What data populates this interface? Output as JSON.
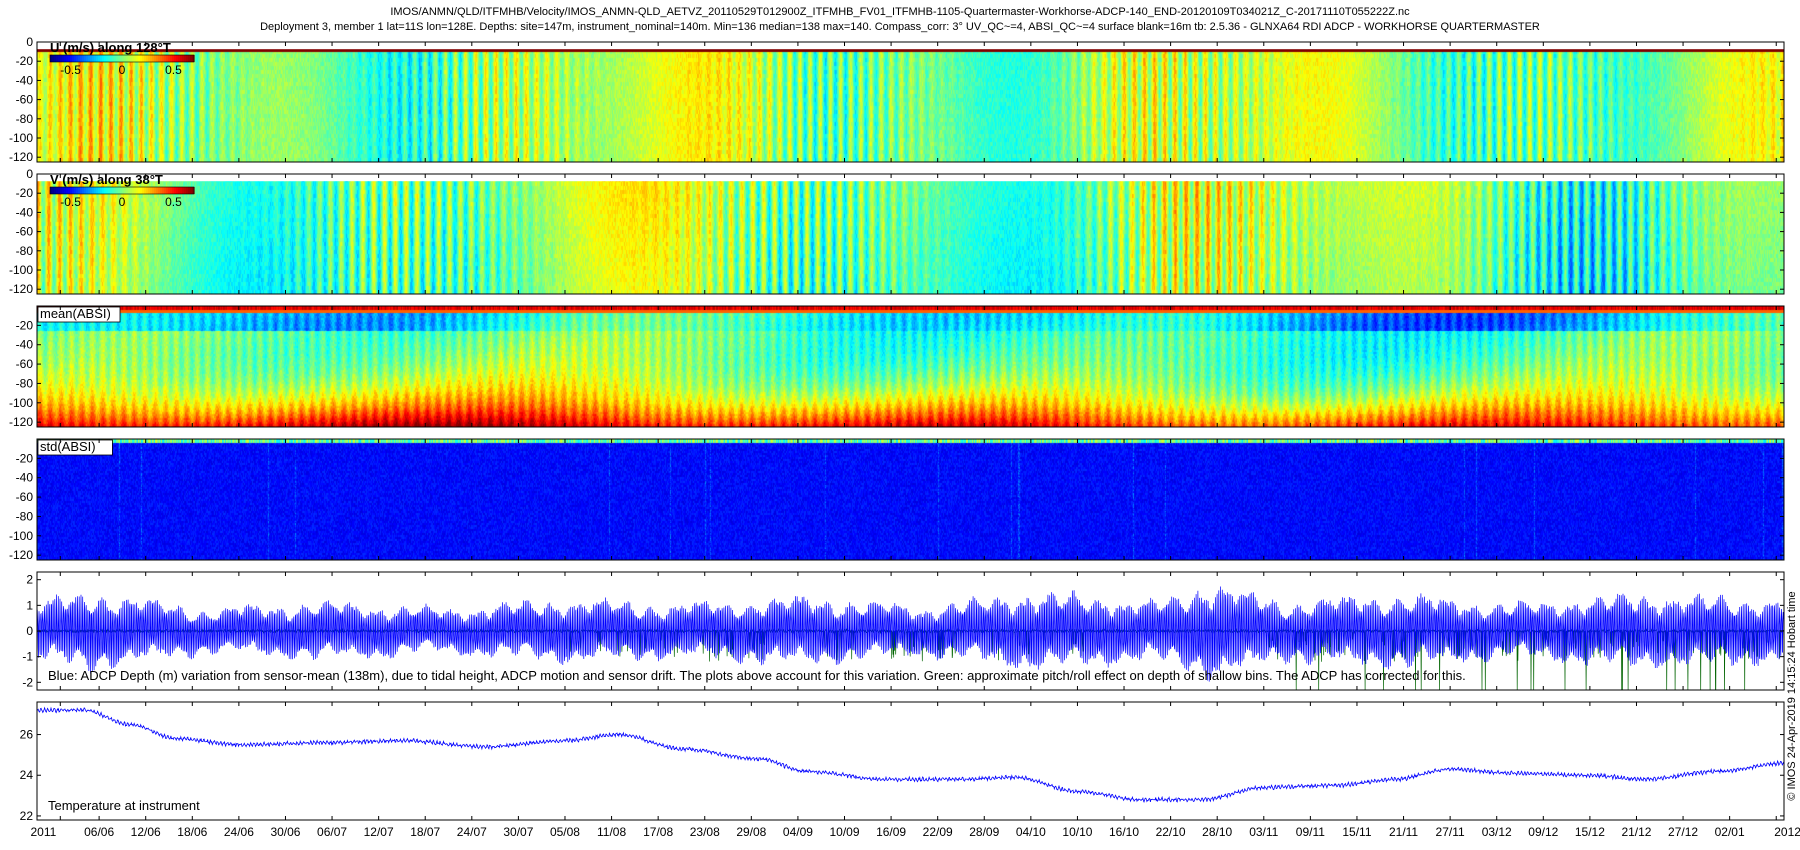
{
  "header": {
    "line1": "IMOS/ANMN/QLD/ITFMHB/Velocity/IMOS_ANMN-QLD_AETVZ_20110529T012900Z_ITFMHB_FV01_ITFMHB-1105-Quartermaster-Workhorse-ADCP-140_END-20120109T034021Z_C-20171110T055222Z.nc",
    "line2": "Deployment 3, member 1 lat=11S lon=128E. Depths: site=147m, instrument_nominal=140m. Min=136 median=138 max=140. Compass_corr: 3° UV_QC~=4, ABSI_QC~=4 surface blank=16m tb: 2.5.36 - GLNXA64 RDI ADCP - WORKHORSE QUARTERMASTER"
  },
  "side_note": "© IMOS 24-Apr-2019 14:15:24 Hobart time",
  "colors": {
    "background": "#ffffff",
    "axis": "#000000",
    "depth_line": "#0000ff",
    "pitch_roll_line": "#006400",
    "temperature_line": "#0000ff",
    "jet_colormap": "jet"
  },
  "colorbar": {
    "ticks": [
      "-0.5",
      "0",
      "0.5"
    ],
    "range": [
      -0.7,
      0.7
    ]
  },
  "chart_data": [
    {
      "type": "heatmap",
      "label": "U (m/s) along 128°T",
      "ylim": [
        -125,
        0
      ],
      "yticks": [
        0,
        -20,
        -40,
        -60,
        -80,
        -100,
        -120
      ],
      "value_range": [
        -0.7,
        0.7
      ],
      "has_colorbar": true,
      "colorbar_ticks": [
        "-0.5",
        "0",
        "0.5"
      ],
      "surface_blank_m": 16,
      "x_start": "2011-05-29",
      "x_end": "2012-01-09"
    },
    {
      "type": "heatmap",
      "label": "V (m/s) along 38°T",
      "ylim": [
        -125,
        0
      ],
      "yticks": [
        0,
        -20,
        -40,
        -60,
        -80,
        -100,
        -120
      ],
      "value_range": [
        -0.7,
        0.7
      ],
      "has_colorbar": true,
      "colorbar_ticks": [
        "-0.5",
        "0",
        "0.5"
      ],
      "surface_blank_m": 16,
      "x_start": "2011-05-29",
      "x_end": "2012-01-09"
    },
    {
      "type": "heatmap",
      "label": "mean(ABSI)",
      "ylim": [
        -125,
        0
      ],
      "yticks": [
        -20,
        -40,
        -60,
        -80,
        -100,
        -120
      ],
      "has_colorbar": false,
      "x_start": "2011-05-29",
      "x_end": "2012-01-09"
    },
    {
      "type": "heatmap",
      "label": "std(ABSI)",
      "ylim": [
        -125,
        0
      ],
      "yticks": [
        -20,
        -40,
        -60,
        -80,
        -100,
        -120
      ],
      "has_colorbar": false,
      "x_start": "2011-05-29",
      "x_end": "2012-01-09"
    },
    {
      "type": "line",
      "ylim": [
        -2.3,
        2.3
      ],
      "yticks": [
        -2,
        -1,
        0,
        1,
        2
      ],
      "annotation": "Blue: ADCP Depth (m) variation from sensor-mean (138m), due to tidal height, ADCP motion and sensor drift. The plots above account for this variation. Green: approximate pitch/roll effect on depth of shallow bins. The ADCP has corrected for this.",
      "series": [
        {
          "color": "#0000ff",
          "envelope_dates": [
            "2011-05-29",
            "2011-06-05",
            "2011-06-20",
            "2011-07-05",
            "2011-07-20",
            "2011-08-05",
            "2011-08-20",
            "2011-09-05",
            "2011-09-20",
            "2011-10-05",
            "2011-10-20",
            "2011-10-28",
            "2011-11-05",
            "2011-11-20",
            "2011-12-05",
            "2011-12-20",
            "2012-01-09"
          ],
          "envelope_amplitude": [
            1.2,
            1.6,
            0.9,
            1.2,
            0.9,
            1.3,
            1.1,
            1.4,
            1.0,
            1.6,
            1.2,
            2.0,
            1.2,
            1.5,
            1.1,
            1.5,
            1.3
          ]
        },
        {
          "color": "#006400",
          "typical_value": 0,
          "spikes_min": -2.3
        }
      ]
    },
    {
      "type": "line",
      "label": "Temperature at instrument",
      "ylim": [
        21.8,
        27.6
      ],
      "yticks": [
        22,
        24,
        26
      ],
      "series": [
        {
          "color": "#0000ff",
          "dates": [
            "2011-05-29",
            "2011-06-04",
            "2011-06-10",
            "2011-06-16",
            "2011-06-24",
            "2011-07-05",
            "2011-07-15",
            "2011-07-26",
            "2011-08-05",
            "2011-08-12",
            "2011-08-20",
            "2011-08-30",
            "2011-09-05",
            "2011-09-15",
            "2011-09-25",
            "2011-10-02",
            "2011-10-10",
            "2011-10-18",
            "2011-10-26",
            "2011-11-03",
            "2011-11-12",
            "2011-11-20",
            "2011-11-27",
            "2011-12-05",
            "2011-12-15",
            "2011-12-22",
            "2012-01-01",
            "2012-01-09"
          ],
          "values": [
            27.2,
            27.2,
            26.5,
            25.8,
            25.5,
            25.6,
            25.7,
            25.4,
            25.7,
            26.0,
            25.3,
            24.8,
            24.2,
            23.8,
            23.8,
            23.9,
            23.2,
            22.8,
            22.8,
            23.4,
            23.5,
            23.8,
            24.3,
            24.1,
            24.0,
            23.8,
            24.2,
            24.6
          ]
        }
      ]
    }
  ],
  "x_axis": {
    "start": "2011-05-29",
    "end": "2012-01-09",
    "tick_labels": [
      "2011",
      "06/06",
      "12/06",
      "18/06",
      "24/06",
      "30/06",
      "06/07",
      "12/07",
      "18/07",
      "24/07",
      "30/07",
      "05/08",
      "11/08",
      "17/08",
      "23/08",
      "29/08",
      "04/09",
      "10/09",
      "16/09",
      "22/09",
      "28/09",
      "04/10",
      "10/10",
      "16/10",
      "22/10",
      "28/10",
      "03/11",
      "09/11",
      "15/11",
      "21/11",
      "27/11",
      "03/12",
      "09/12",
      "15/12",
      "21/12",
      "27/12",
      "02/01",
      "2012"
    ],
    "tick_dates": [
      "2011-06-01",
      "2011-06-06",
      "2011-06-12",
      "2011-06-18",
      "2011-06-24",
      "2011-06-30",
      "2011-07-06",
      "2011-07-12",
      "2011-07-18",
      "2011-07-24",
      "2011-07-30",
      "2011-08-05",
      "2011-08-11",
      "2011-08-17",
      "2011-08-23",
      "2011-08-29",
      "2011-09-04",
      "2011-09-10",
      "2011-09-16",
      "2011-09-22",
      "2011-09-28",
      "2011-10-04",
      "2011-10-10",
      "2011-10-16",
      "2011-10-22",
      "2011-10-28",
      "2011-11-03",
      "2011-11-09",
      "2011-11-15",
      "2011-11-21",
      "2011-11-27",
      "2011-12-03",
      "2011-12-09",
      "2011-12-15",
      "2011-12-21",
      "2011-12-27",
      "2012-01-02",
      "2012-01-08"
    ]
  }
}
